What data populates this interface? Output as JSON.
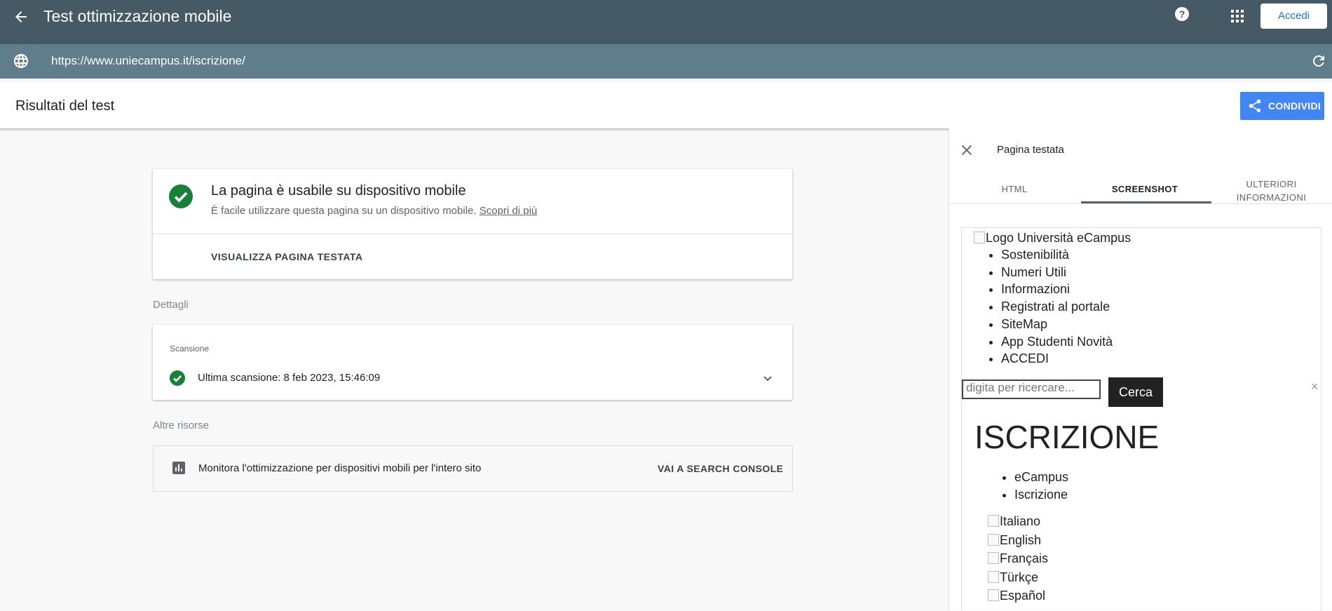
{
  "appbar": {
    "title": "Test ottimizzazione mobile",
    "help_icon": "help-icon",
    "apps_icon": "apps-grid-icon",
    "signin_label": "Accedi"
  },
  "urlbar": {
    "url": "https://www.uniecampus.it/iscrizione/"
  },
  "results": {
    "title": "Risultati del test",
    "share_label": "CONDIVIDI"
  },
  "summary": {
    "heading": "La pagina è usabile su dispositivo mobile",
    "subtitle": "È facile utilizzare questa pagina su un dispositivo mobile.",
    "learn_more": "Scopri di più",
    "view_button": "VISUALIZZA PAGINA TESTATA"
  },
  "details": {
    "section_label": "Dettagli",
    "scan_label": "Scansione",
    "scan_text": "Ultima scansione: 8 feb 2023, 15:46:09"
  },
  "resources": {
    "section_label": "Altre risorse",
    "text": "Monitora l'ottimizzazione per dispositivi mobili per l'intero sito",
    "link": "VAI A SEARCH CONSOLE"
  },
  "panel": {
    "title": "Pagina testata",
    "tabs": [
      "HTML",
      "SCREENSHOT",
      "ULTERIORI",
      "INFORMAZIONI"
    ],
    "active_tab": "SCREENSHOT"
  },
  "screenshot": {
    "logo_alt": "Logo Università eCampus",
    "nav_items": [
      "Sostenibilità",
      "Numeri Utili",
      "Informazioni",
      "Registrati al portale",
      "SiteMap",
      "App Studenti Novità",
      "ACCEDI"
    ],
    "search_placeholder": "digita per ricercare...",
    "search_button": "Cerca",
    "close_glyph": "×",
    "heading": "ISCRIZIONE",
    "breadcrumb": [
      "eCampus",
      "Iscrizione"
    ],
    "languages": [
      "Italiano",
      "English",
      "Français",
      "Türkçe",
      "Español"
    ]
  },
  "colors": {
    "appbar": "#455a64",
    "urlbar": "#607d8b",
    "accent": "#4285f4",
    "success": "#188038"
  }
}
